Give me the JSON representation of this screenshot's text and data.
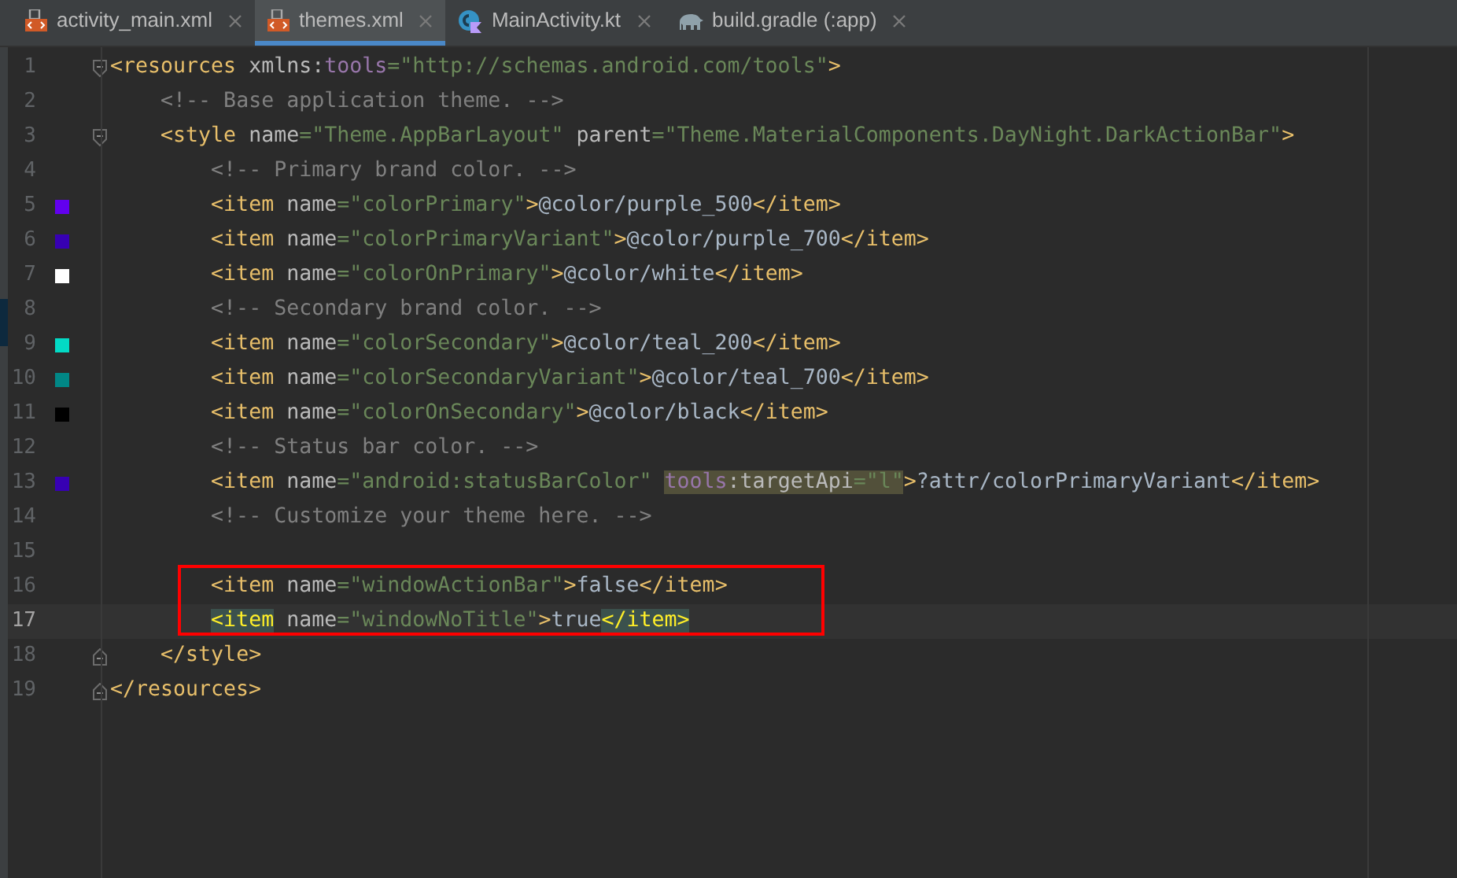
{
  "tabs": [
    {
      "label": "activity_main.xml",
      "kind": "xml",
      "selected": false
    },
    {
      "label": "themes.xml",
      "kind": "xml",
      "selected": true
    },
    {
      "label": "MainActivity.kt",
      "kind": "kotlin",
      "selected": false
    },
    {
      "label": "build.gradle (:app)",
      "kind": "gradle",
      "selected": false
    }
  ],
  "editor": {
    "lines": [
      {
        "number": "1",
        "fold_start": true,
        "current": false,
        "tokens": [
          {
            "kind": "tag",
            "t": "<resources "
          },
          {
            "kind": "attr",
            "t": "xmlns:"
          },
          {
            "kind": "ns",
            "t": "tools"
          },
          {
            "kind": "val",
            "t": "=\"http://schemas.android.com/tools\""
          },
          {
            "kind": "tag",
            "t": ">"
          }
        ]
      },
      {
        "number": "2",
        "current": false,
        "tokens": [
          {
            "kind": "comment",
            "t": "    <!-- Base application theme. -->"
          }
        ]
      },
      {
        "number": "3",
        "fold_start": true,
        "current": false,
        "tokens": [
          {
            "kind": "tag",
            "t": "    <style "
          },
          {
            "kind": "attr",
            "t": "name"
          },
          {
            "kind": "val",
            "t": "=\"Theme.AppBarLayout\" "
          },
          {
            "kind": "attr",
            "t": "parent"
          },
          {
            "kind": "val",
            "t": "=\"Theme.MaterialComponents.DayNight.DarkActionBar\""
          },
          {
            "kind": "tag",
            "t": ">"
          }
        ]
      },
      {
        "number": "4",
        "current": false,
        "tokens": [
          {
            "kind": "comment",
            "t": "        <!-- Primary brand color. -->"
          }
        ]
      },
      {
        "number": "5",
        "color": "#6200ee",
        "current": false,
        "tokens": [
          {
            "kind": "tag",
            "t": "        <item "
          },
          {
            "kind": "attr",
            "t": "name"
          },
          {
            "kind": "val",
            "t": "=\"colorPrimary\""
          },
          {
            "kind": "tag",
            "t": ">"
          },
          {
            "kind": "text",
            "t": "@color/purple_500"
          },
          {
            "kind": "tag",
            "t": "</item>"
          }
        ]
      },
      {
        "number": "6",
        "color": "#3700b3",
        "current": false,
        "tokens": [
          {
            "kind": "tag",
            "t": "        <item "
          },
          {
            "kind": "attr",
            "t": "name"
          },
          {
            "kind": "val",
            "t": "=\"colorPrimaryVariant\""
          },
          {
            "kind": "tag",
            "t": ">"
          },
          {
            "kind": "text",
            "t": "@color/purple_700"
          },
          {
            "kind": "tag",
            "t": "</item>"
          }
        ]
      },
      {
        "number": "7",
        "color": "#ffffff",
        "current": false,
        "tokens": [
          {
            "kind": "tag",
            "t": "        <item "
          },
          {
            "kind": "attr",
            "t": "name"
          },
          {
            "kind": "val",
            "t": "=\"colorOnPrimary\""
          },
          {
            "kind": "tag",
            "t": ">"
          },
          {
            "kind": "text",
            "t": "@color/white"
          },
          {
            "kind": "tag",
            "t": "</item>"
          }
        ]
      },
      {
        "number": "8",
        "current": false,
        "tokens": [
          {
            "kind": "comment",
            "t": "        <!-- Secondary brand color. -->"
          }
        ]
      },
      {
        "number": "9",
        "color": "#03dac5",
        "current": false,
        "tokens": [
          {
            "kind": "tag",
            "t": "        <item "
          },
          {
            "kind": "attr",
            "t": "name"
          },
          {
            "kind": "val",
            "t": "=\"colorSecondary\""
          },
          {
            "kind": "tag",
            "t": ">"
          },
          {
            "kind": "text",
            "t": "@color/teal_200"
          },
          {
            "kind": "tag",
            "t": "</item>"
          }
        ]
      },
      {
        "number": "10",
        "color": "#018786",
        "current": false,
        "tokens": [
          {
            "kind": "tag",
            "t": "        <item "
          },
          {
            "kind": "attr",
            "t": "name"
          },
          {
            "kind": "val",
            "t": "=\"colorSecondaryVariant\""
          },
          {
            "kind": "tag",
            "t": ">"
          },
          {
            "kind": "text",
            "t": "@color/teal_700"
          },
          {
            "kind": "tag",
            "t": "</item>"
          }
        ]
      },
      {
        "number": "11",
        "color": "#000000",
        "current": false,
        "tokens": [
          {
            "kind": "tag",
            "t": "        <item "
          },
          {
            "kind": "attr",
            "t": "name"
          },
          {
            "kind": "val",
            "t": "=\"colorOnSecondary\""
          },
          {
            "kind": "tag",
            "t": ">"
          },
          {
            "kind": "text",
            "t": "@color/black"
          },
          {
            "kind": "tag",
            "t": "</item>"
          }
        ]
      },
      {
        "number": "12",
        "current": false,
        "tokens": [
          {
            "kind": "comment",
            "t": "        <!-- Status bar color. -->"
          }
        ]
      },
      {
        "number": "13",
        "color": "#3700b3",
        "current": false,
        "tokens": [
          {
            "kind": "tag",
            "t": "        <item "
          },
          {
            "kind": "attr",
            "t": "name"
          },
          {
            "kind": "val",
            "t": "=\"android:statusBarColor\" "
          },
          {
            "kind": "ns",
            "t": "tools",
            "highlighted": true
          },
          {
            "kind": "attr",
            "t": ":targetApi",
            "highlighted": true
          },
          {
            "kind": "val",
            "t": "=\"l\"",
            "highlighted": true
          },
          {
            "kind": "tag",
            "t": ">"
          },
          {
            "kind": "text",
            "t": "?attr/colorPrimaryVariant"
          },
          {
            "kind": "tag",
            "t": "</item>"
          }
        ]
      },
      {
        "number": "14",
        "current": false,
        "tokens": [
          {
            "kind": "comment",
            "t": "        <!-- Customize your theme here. -->"
          }
        ]
      },
      {
        "number": "15",
        "current": false
      },
      {
        "number": "16",
        "current": false,
        "tokens": [
          {
            "kind": "tag",
            "t": "        <item "
          },
          {
            "kind": "attr",
            "t": "name"
          },
          {
            "kind": "val",
            "t": "=\"windowActionBar\""
          },
          {
            "kind": "tag",
            "t": ">"
          },
          {
            "kind": "text",
            "t": "false"
          },
          {
            "kind": "tag",
            "t": "</item>"
          }
        ]
      },
      {
        "number": "17",
        "current": true,
        "tokens": [
          {
            "kind": "tag",
            "t": "        <item",
            "matched": true
          },
          {
            "kind": "attr",
            "t": " name"
          },
          {
            "kind": "val",
            "t": "=\"windowNoTitle\""
          },
          {
            "kind": "tag",
            "t": ">"
          },
          {
            "kind": "text",
            "t": "true"
          },
          {
            "kind": "tag",
            "t": "</item>",
            "matched": true
          }
        ]
      },
      {
        "number": "18",
        "fold_end": true,
        "current": false,
        "tokens": [
          {
            "kind": "tag",
            "t": "    </style>"
          }
        ]
      },
      {
        "number": "19",
        "fold_end": true,
        "current": false,
        "tokens": [
          {
            "kind": "tag",
            "t": "</resources>"
          }
        ]
      }
    ]
  }
}
